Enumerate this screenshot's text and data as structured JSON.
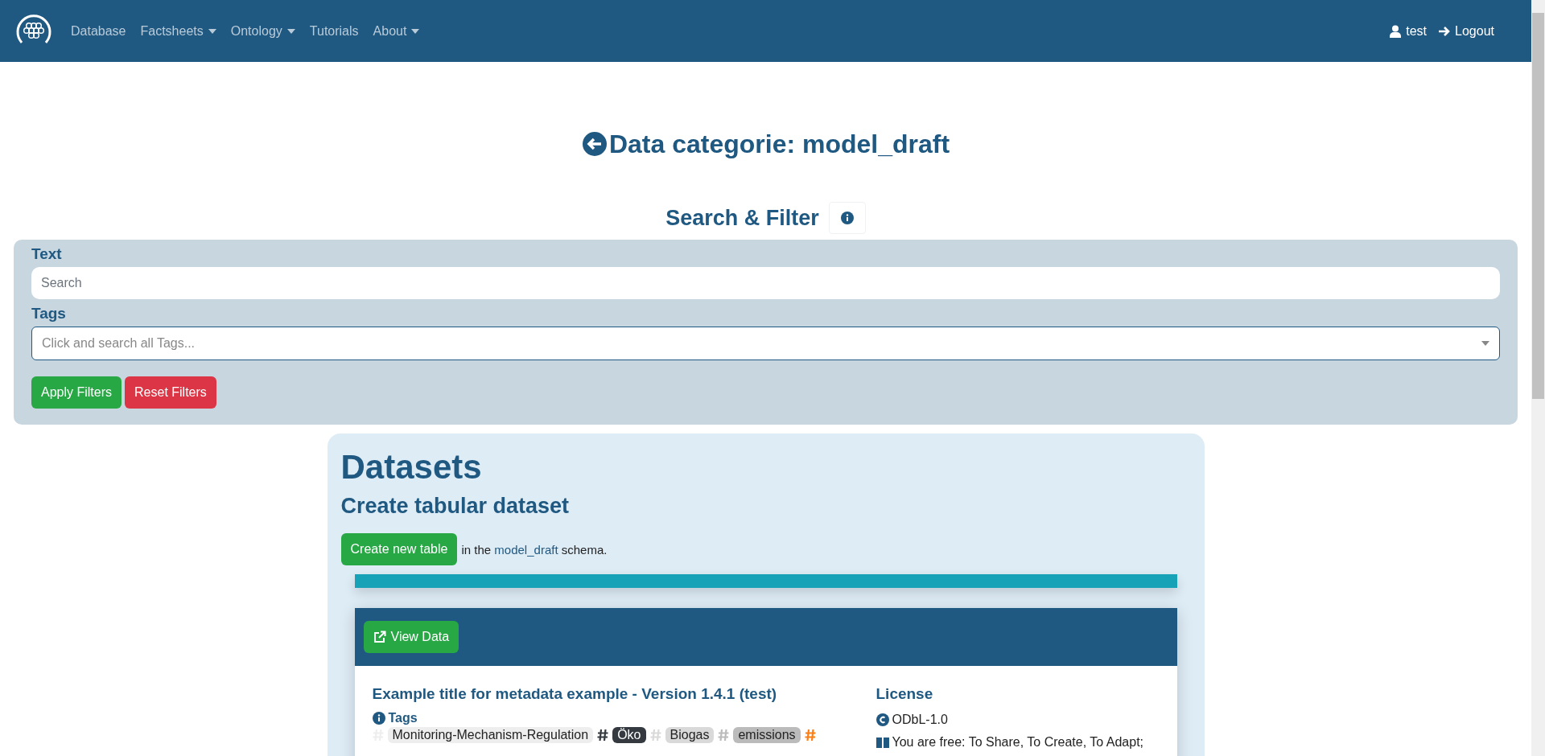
{
  "navbar": {
    "links": [
      {
        "label": "Database",
        "dropdown": false
      },
      {
        "label": "Factsheets",
        "dropdown": true
      },
      {
        "label": "Ontology",
        "dropdown": true
      },
      {
        "label": "Tutorials",
        "dropdown": false
      },
      {
        "label": "About",
        "dropdown": true
      }
    ],
    "user": "test",
    "logout": "Logout"
  },
  "page_title": "Data categorie: model_draft",
  "filter": {
    "heading": "Search & Filter",
    "text_label": "Text",
    "search_placeholder": "Search",
    "tags_label": "Tags",
    "tags_placeholder": "Click and search all Tags...",
    "apply": "Apply Filters",
    "reset": "Reset Filters"
  },
  "datasets": {
    "heading": "Datasets",
    "subheading": "Create tabular dataset",
    "create_button": "Create new table",
    "sentence_before": "in the",
    "schema_link": "model_draft",
    "sentence_after": "schema.",
    "card": {
      "view_button": "View Data",
      "title": "Example title for metadata example - Version 1.4.1 (test)",
      "tags_heading": "Tags",
      "tags": [
        {
          "label": "Monitoring-Mechanism-Regulation",
          "color": "#eeeeee"
        },
        {
          "label": "Öko",
          "color": "#343a40"
        },
        {
          "label": "Biogas",
          "color": "#d9d9d9"
        },
        {
          "label": "emissions",
          "color": "#bbbbbb"
        }
      ],
      "trailing_hash": {
        "color": "#fd7e14"
      },
      "license_heading": "License",
      "license": "ODbL-1.0",
      "license_text": "You are free: To Share, To Create, To Adapt;"
    }
  }
}
